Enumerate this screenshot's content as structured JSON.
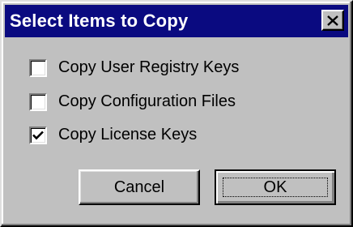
{
  "dialog": {
    "title": "Select Items to Copy",
    "close_icon": "close-icon"
  },
  "options": [
    {
      "label": "Copy User Registry Keys",
      "checked": false
    },
    {
      "label": "Copy Configuration Files",
      "checked": false
    },
    {
      "label": "Copy License Keys",
      "checked": true
    }
  ],
  "buttons": {
    "cancel_label": "Cancel",
    "ok_label": "OK"
  },
  "colors": {
    "titlebar": "#0a0a80",
    "face": "#c0c0c0"
  }
}
